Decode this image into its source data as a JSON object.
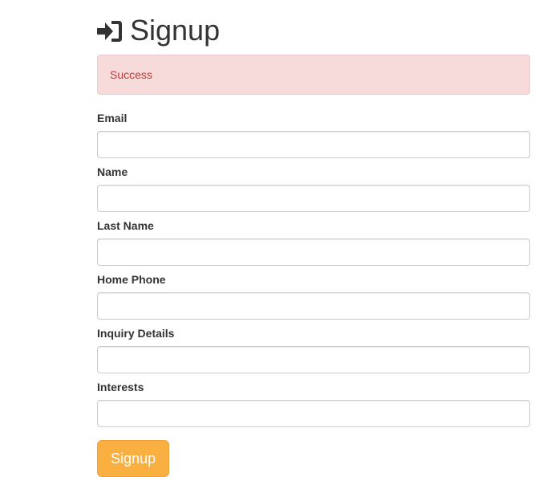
{
  "header": {
    "icon": "sign-in-icon",
    "title": "Signup"
  },
  "alert": {
    "message": "Success",
    "color": "#c23a37",
    "background": "#f7dada"
  },
  "form": {
    "fields": [
      {
        "label": "Email",
        "value": "",
        "placeholder": ""
      },
      {
        "label": "Name",
        "value": "",
        "placeholder": ""
      },
      {
        "label": "Last Name",
        "value": "",
        "placeholder": ""
      },
      {
        "label": "Home Phone",
        "value": "",
        "placeholder": ""
      },
      {
        "label": "Inquiry Details",
        "value": "",
        "placeholder": ""
      },
      {
        "label": "Interests",
        "value": "",
        "placeholder": ""
      }
    ],
    "submit_label": "Signup",
    "submit_color": "#f9b040"
  }
}
